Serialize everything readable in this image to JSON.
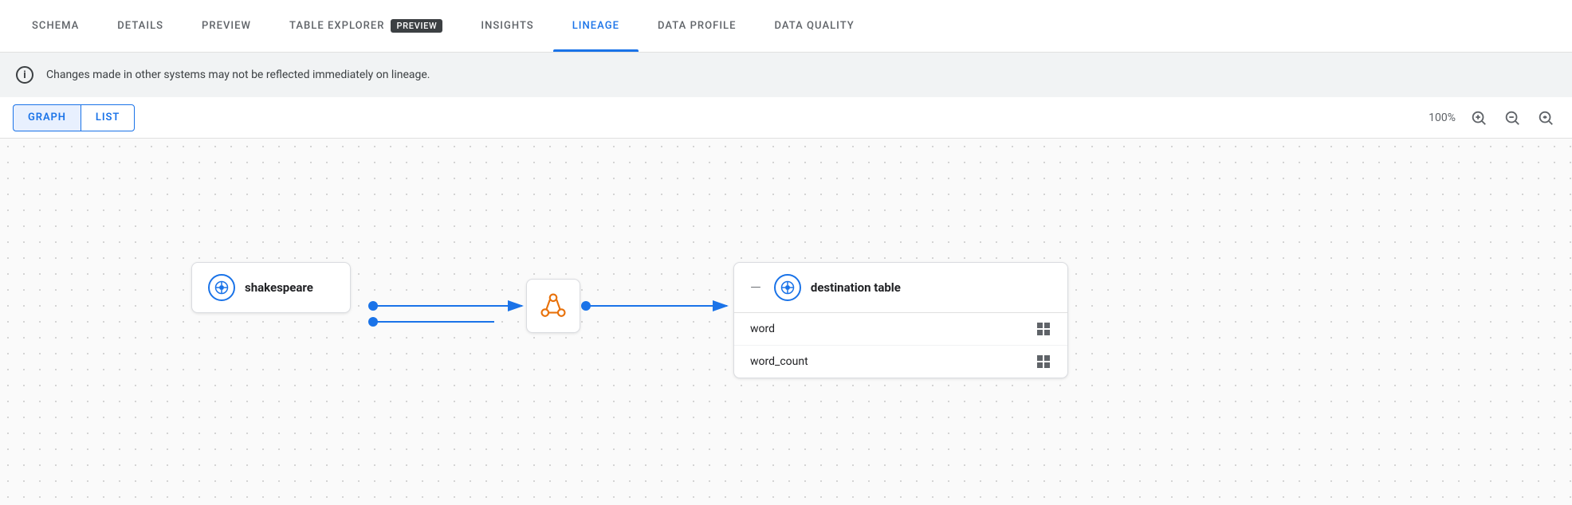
{
  "tabs": [
    {
      "id": "schema",
      "label": "SCHEMA",
      "active": false
    },
    {
      "id": "details",
      "label": "DETAILS",
      "active": false
    },
    {
      "id": "preview",
      "label": "PREVIEW",
      "active": false
    },
    {
      "id": "table-explorer",
      "label": "TABLE EXPLORER",
      "badge": "PREVIEW",
      "active": false
    },
    {
      "id": "insights",
      "label": "INSIGHTS",
      "active": false
    },
    {
      "id": "lineage",
      "label": "LINEAGE",
      "active": true
    },
    {
      "id": "data-profile",
      "label": "DATA PROFILE",
      "active": false
    },
    {
      "id": "data-quality",
      "label": "DATA QUALITY",
      "active": false
    }
  ],
  "banner": {
    "text": "Changes made in other systems may not be reflected immediately on lineage."
  },
  "toolbar": {
    "graph_label": "GRAPH",
    "list_label": "LIST",
    "zoom_level": "100%"
  },
  "lineage": {
    "source": {
      "name": "shakespeare"
    },
    "destination": {
      "name": "destination table",
      "fields": [
        {
          "name": "word"
        },
        {
          "name": "word_count"
        }
      ]
    }
  },
  "icons": {
    "info": "ℹ",
    "zoom_in": "⊕",
    "zoom_out": "⊖",
    "zoom_reset": "⟳"
  }
}
